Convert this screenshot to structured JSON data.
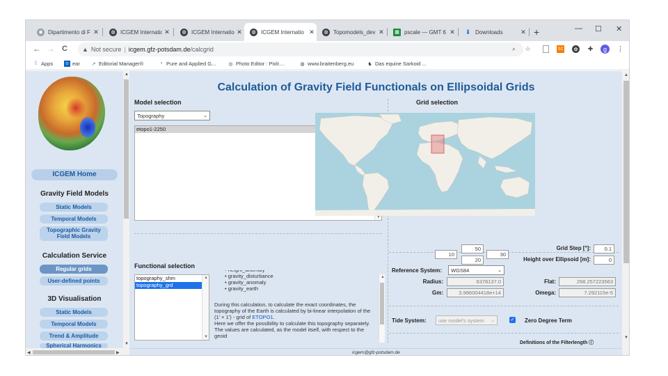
{
  "browser": {
    "tabs": [
      {
        "title": "Dipartimento di F",
        "icon": "globe-icon",
        "icon_color": "#5f6368"
      },
      {
        "title": "ICGEM Internatio",
        "icon": "chrome-globe-icon",
        "icon_color": "#3c4043"
      },
      {
        "title": "ICGEM Internatio",
        "icon": "chrome-globe-icon",
        "icon_color": "#3c4043"
      },
      {
        "title": "ICGEM Internatio",
        "icon": "chrome-globe-icon",
        "icon_color": "#3c4043",
        "active": true
      },
      {
        "title": "Topomodels_dev",
        "icon": "chrome-globe-icon",
        "icon_color": "#3c4043"
      },
      {
        "title": "pscale — GMT 6",
        "icon": "gmt-doc-icon",
        "icon_color": "#1e8e3e"
      },
      {
        "title": "Downloads",
        "icon": "download-icon",
        "icon_color": "#1a73e8"
      }
    ],
    "close_glyph": "✕",
    "new_tab_glyph": "+",
    "window_controls": {
      "minimize": "—",
      "maximize": "☐",
      "close": "✕"
    },
    "nav": {
      "back": "←",
      "forward": "→",
      "reload": "C"
    },
    "address": {
      "security": "Not secure",
      "host": "icgem.gfz-potsdam.de",
      "path": "/calcgrid"
    },
    "toolbar_icons": [
      "zoom-icon",
      "star-icon",
      "reading-list-icon",
      "extension-sc-icon",
      "extension-circle-icon",
      "puzzle-extensions-icon",
      "profile-avatar",
      "menu-kebab-icon"
    ],
    "profile_initial": "g",
    "bookmarks": [
      {
        "label": "Apps",
        "icon": "apps-grid-icon"
      },
      {
        "label": "ear",
        "icon": "outlook-icon"
      },
      {
        "label": "Editorial Manager®",
        "icon": "em-icon"
      },
      {
        "label": "Pure and Applied G...",
        "icon": "springer-icon"
      },
      {
        "label": "Photo Editor : Pixlr....",
        "icon": "pixlr-icon"
      },
      {
        "label": "www.braitenberg.eu",
        "icon": "globe-icon"
      },
      {
        "label": "Das equine Sarkoid ...",
        "icon": "horse-icon"
      }
    ]
  },
  "sidebar": {
    "home_label": "ICGEM Home",
    "sections": [
      {
        "title": "Gravity Field Models",
        "items": [
          "Static Models",
          "Temporal Models",
          "Topographic Gravity Field Models"
        ]
      },
      {
        "title": "Calculation Service",
        "items": [
          "Regular grids",
          "User-defined points"
        ]
      },
      {
        "title": "3D Visualisation",
        "items": [
          "Static Models",
          "Temporal Models",
          "Trend & Amplitude",
          "Spherical Harmonics"
        ]
      }
    ],
    "topographic_line1": "Topographic Gravity",
    "topographic_line2": "Field Models"
  },
  "main": {
    "title": "Calculation of Gravity Field Functionals on Ellipsoidal Grids",
    "model_selection": {
      "heading": "Model selection",
      "dropdown_value": "Topography",
      "models": [
        "etopo1-2250"
      ]
    },
    "grid_selection": {
      "heading": "Grid selection",
      "bounds": {
        "north": "50",
        "south": "20",
        "west": "10",
        "east": "30"
      },
      "grid_step_label": "Grid Step [°]:",
      "grid_step_value": "0.1",
      "height_label": "Height over Ellipsoid [m]:",
      "height_value": "0"
    },
    "functional_selection": {
      "heading": "Functional selection",
      "list": [
        "topography_shm",
        "topography_grd"
      ],
      "selected_index": 1,
      "bullets_partial": "height_anomaly",
      "bullets": [
        "gravity_disturbance",
        "gravity_anomaly",
        "gravity_earth"
      ],
      "desc1": "During this calculation, to calculate the exact coordinates, the topography of the Earth is calculated by bi-linear interpolation of the (1' × 1') - grid of",
      "desc_link": "ETOPO1",
      "desc1_end": ".",
      "desc2": "Here we offer the possibility to calculate this topography separately.",
      "desc3": "The values are calculated, as the model itself, with respect to the geoid"
    },
    "reference": {
      "system_label": "Reference System:",
      "system_value": "WGS84",
      "radius_label": "Radius:",
      "radius_value": "6378137.0",
      "flat_label": "Flat:",
      "flat_value": "298.257223563",
      "gm_label": "Gm:",
      "gm_value": "3.986004418e+14",
      "omega_label": "Omega:",
      "omega_value": "7.292115e-5"
    },
    "tide": {
      "label": "Tide System:",
      "value": "use model's system",
      "zero_degree_label": "Zero Degree Term",
      "zero_degree_checked": true
    },
    "filter_link": "Definitions of the Filterlength ⓘ"
  },
  "footer": {
    "email": "icgem@gfz-potsdam.de"
  },
  "colors": {
    "page_bg": "#dce6f2",
    "accent": "#1d5b98",
    "button_bg": "#bcd3ec",
    "active_button": "#6b95c5",
    "map_water": "#aad3df",
    "map_land": "#f2efe9",
    "selection_box": "#e58c8c"
  }
}
